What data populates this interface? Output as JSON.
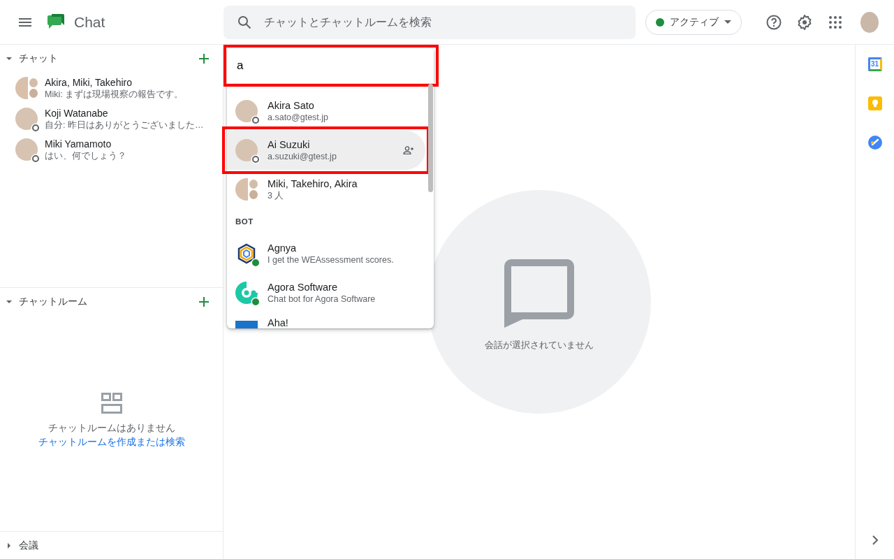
{
  "header": {
    "app_name": "Chat",
    "search_placeholder": "チャットとチャットルームを検索",
    "status_label": "アクティブ"
  },
  "sidebar": {
    "sections": [
      {
        "kind": "chats",
        "title": "チャット",
        "expanded": true,
        "items": [
          {
            "kind": "group",
            "name": "Akira, Miki, Takehiro",
            "snippet": "Miki: まずは現場視察の報告です。"
          },
          {
            "kind": "person",
            "name": "Koji Watanabe",
            "snippet": "自分: 昨日はありがとうございました…",
            "online": false
          },
          {
            "kind": "person",
            "name": "Miki Yamamoto",
            "snippet": "はい、何でしょう？",
            "online": false
          }
        ]
      },
      {
        "kind": "rooms",
        "title": "チャットルーム",
        "expanded": true,
        "empty_text": "チャットルームはありません",
        "empty_link": "チャットルームを作成または検索"
      },
      {
        "kind": "meetings",
        "title": "会議",
        "expanded": false
      }
    ]
  },
  "search_popup": {
    "query": "a",
    "highlighted": true,
    "results": [
      {
        "kind": "person",
        "name": "Akira Sato",
        "detail": "a.sato@gtest.jp",
        "online": false,
        "selected": false,
        "highlighted": false
      },
      {
        "kind": "person",
        "name": "Ai Suzuki",
        "detail": "a.suzuki@gtest.jp",
        "online": false,
        "selected": true,
        "highlighted": true
      },
      {
        "kind": "group",
        "name": "Miki, Takehiro, Akira",
        "detail": "3 人",
        "selected": false,
        "highlighted": false
      },
      {
        "kind": "heading",
        "name": "BOT"
      },
      {
        "kind": "hexagon-bot",
        "name": "Agnya",
        "detail": "I get the WEAssessment scores.",
        "online": true,
        "selected": false,
        "highlighted": false
      },
      {
        "kind": "ring-bot",
        "name": "Agora Software",
        "detail": "Chat bot for Agora Software",
        "online": true,
        "selected": false,
        "highlighted": false
      },
      {
        "kind": "square-bot",
        "name": "Aha!",
        "selected": false,
        "highlighted": false
      }
    ]
  },
  "main": {
    "empty_text": "会話が選択されていません"
  },
  "right_rail": {
    "calendar_day": "31"
  }
}
